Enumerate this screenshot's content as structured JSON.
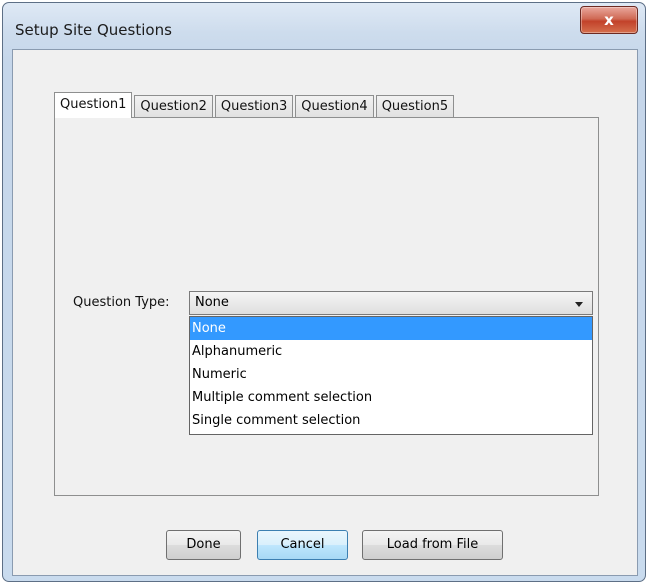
{
  "window": {
    "title": "Setup Site Questions",
    "close_glyph": "x"
  },
  "tabs": [
    {
      "label": "Question1",
      "active": true
    },
    {
      "label": "Question2",
      "active": false
    },
    {
      "label": "Question3",
      "active": false
    },
    {
      "label": "Question4",
      "active": false
    },
    {
      "label": "Question5",
      "active": false
    }
  ],
  "question_type": {
    "label": "Question Type:",
    "selected": "None",
    "options": [
      "None",
      "Alphanumeric",
      "Numeric",
      "Multiple comment selection",
      "Single comment selection"
    ],
    "highlighted_index": 0
  },
  "buttons": {
    "done": "Done",
    "cancel": "Cancel",
    "load_from_file": "Load from File"
  },
  "colors": {
    "selection": "#3399ff",
    "close_button": "#c2422a",
    "frame": "#c5d6ea"
  }
}
